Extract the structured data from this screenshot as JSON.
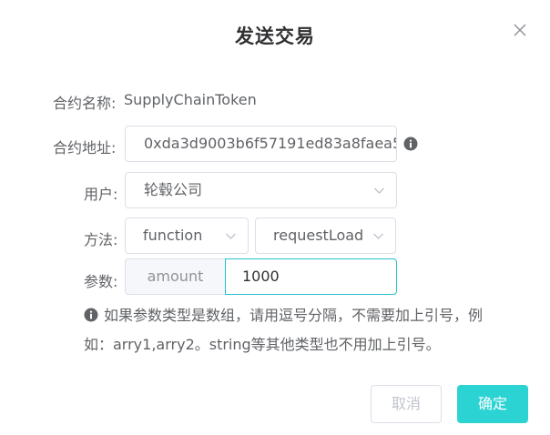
{
  "dialog": {
    "title": "发送交易"
  },
  "form": {
    "contract_name_label": "合约名称:",
    "contract_name_value": "SupplyChainToken",
    "contract_address_label": "合约地址:",
    "contract_address_value": "0xda3d9003b6f57191ed83a8faea5",
    "user_label": "用户:",
    "user_value": "轮毂公司",
    "method_label": "方法:",
    "method_type_value": "function",
    "method_name_value": "requestLoad",
    "params_label": "参数:",
    "param_name": "amount",
    "param_value": "1000",
    "hint_line1": "如果参数类型是数组，请用逗号分隔，不需要加上引号，例",
    "hint_line2": "如：arry1,arry2。string等其他类型也不用加上引号。"
  },
  "buttons": {
    "cancel_label": "取消",
    "confirm_label": "确定"
  },
  "colors": {
    "accent": "#2bd3d3",
    "focus_border": "#27c0cc"
  },
  "icons": {
    "close": "close-icon",
    "info": "info-icon",
    "dropdown": "chevron-down-icon"
  }
}
